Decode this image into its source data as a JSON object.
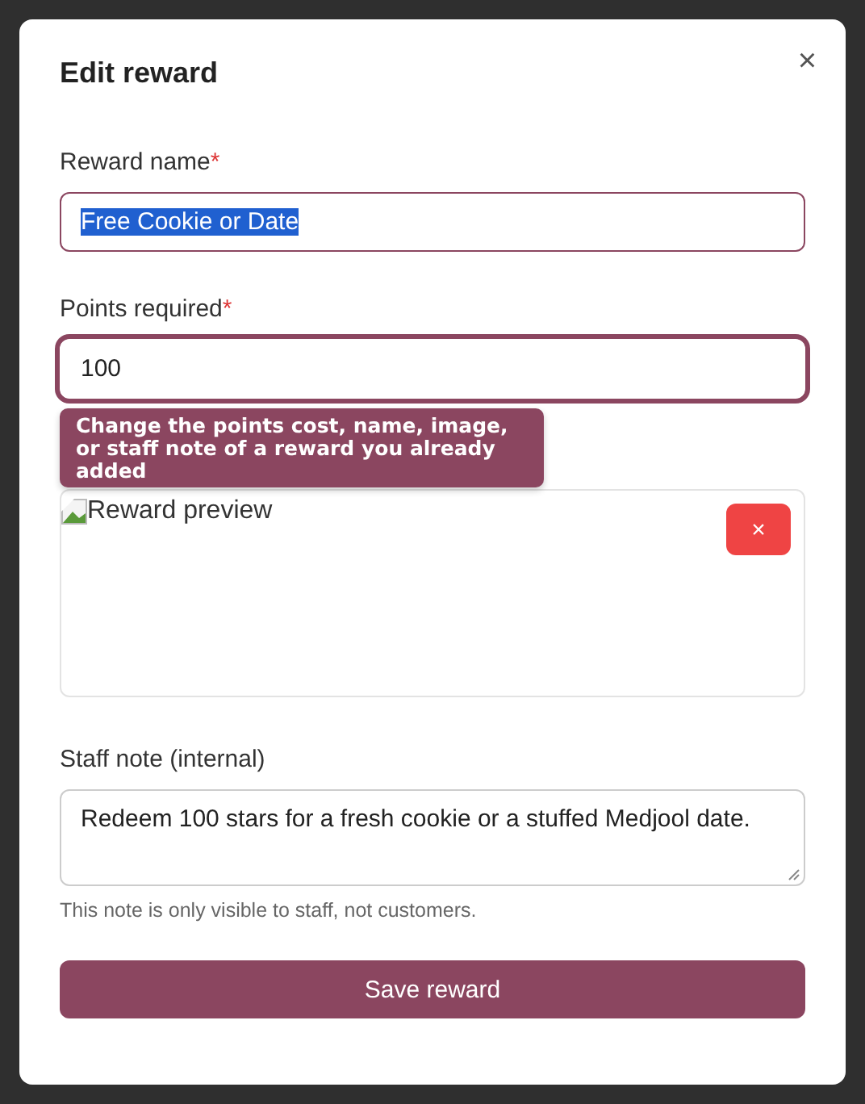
{
  "dialog": {
    "title": "Edit reward",
    "close_label": "×"
  },
  "fields": [
    {
      "kind": "text",
      "label": "Reward name",
      "required_mark": "*",
      "value": "Free Cookie or Date",
      "text_selected": true,
      "focused": false
    },
    {
      "kind": "text",
      "label": "Points required",
      "required_mark": "*",
      "value": "100",
      "text_selected": false,
      "focused": true
    }
  ],
  "tooltip": "Change the points cost, name, image, or staff note of a reward you already added",
  "image_preview": {
    "alt_text": "Reward preview",
    "remove_label": "×"
  },
  "staff_note": {
    "label": "Staff note (internal)",
    "value": "Redeem 100 stars for a fresh cookie or a stuffed Medjool date.",
    "hint": "This note is only visible to staff, not customers."
  },
  "save_button": "Save reward"
}
